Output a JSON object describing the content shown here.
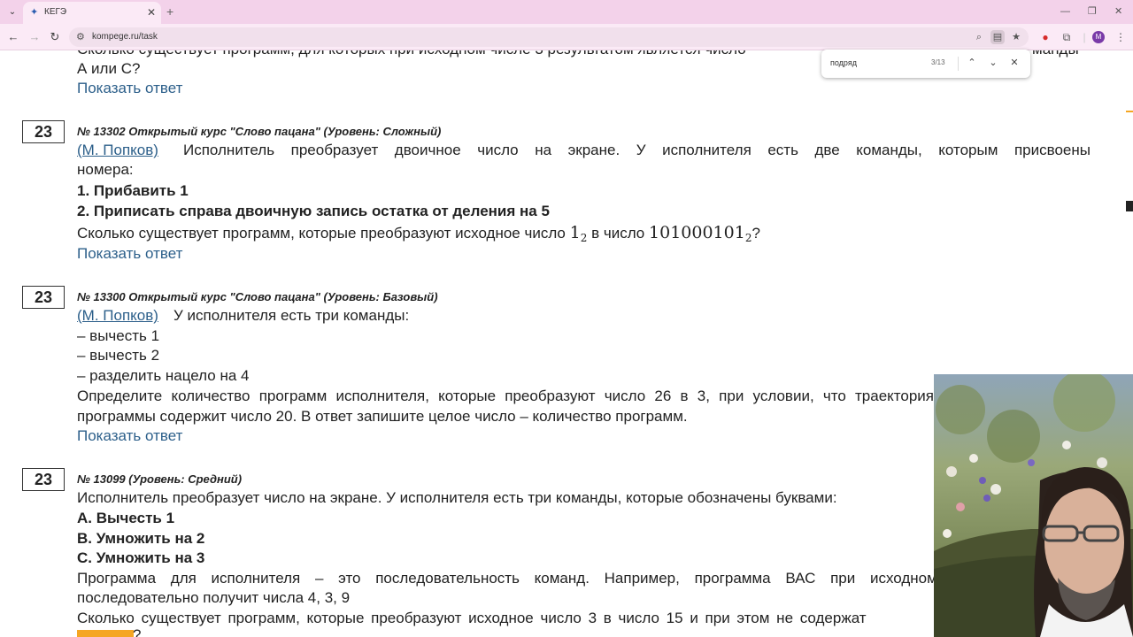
{
  "browser": {
    "tab_title": "КЕГЭ",
    "url": "kompege.ru/task",
    "profile_initial": "M",
    "icons": {
      "tab_list": "chevron-down-icon",
      "tab_favicon": "kegje-favicon-icon",
      "tab_close": "close-icon",
      "new_tab": "plus-icon",
      "back": "arrow-left-icon",
      "forward": "arrow-right-icon",
      "reload": "reload-icon",
      "site_info": "site-settings-icon",
      "zoom": "zoom-icon",
      "reader": "reading-mode-icon",
      "bookmark": "star-icon",
      "extension": "extension-red-icon",
      "extensions": "puzzle-icon",
      "menu": "kebab-menu-icon"
    },
    "find": {
      "query": "подряд",
      "count": "3/13"
    }
  },
  "page": {
    "top_partial": {
      "line1": "Сколько существует программ, для которых при исходном числе 3 результатом является число",
      "line1_tail": "манды",
      "line2": "А или С?",
      "answer_link": "Показать ответ"
    },
    "tasks": [
      {
        "number": "23",
        "meta": "№ 13302 Открытый курс \"Слово пацана\" (Уровень: Сложный)",
        "author": "(М. Попков)",
        "intro": "Исполнитель преобразует двоичное число на экране. У исполнителя есть две команды, которым присвоены",
        "intro2": "номера:",
        "cmd1": "1. Прибавить 1",
        "cmd2": "2. Приписать справа двоичную запись остатка от деления на 5",
        "question_a": "Сколько существует программ, которые преобразуют исходное число",
        "math1": "1",
        "math1_sub": "2",
        "question_b": "в число",
        "math2": "101000101",
        "math2_sub": "2",
        "question_end": "?",
        "answer_link": "Показать ответ"
      },
      {
        "number": "23",
        "meta": "№ 13300 Открытый курс \"Слово пацана\" (Уровень: Базовый)",
        "author": "(М. Попков)",
        "intro": "У исполнителя есть три команды:",
        "cmd1": "– вычесть 1",
        "cmd2": "– вычесть 2",
        "cmd3": "– разделить нацело на 4",
        "body1": "Определите количество программ исполнителя, которые преобразуют число 26 в 3, при условии, что траектория",
        "body2": "программы содержит число 20. В ответ запишите целое число – количество программ.",
        "answer_link": "Показать ответ"
      },
      {
        "number": "23",
        "meta": "№ 13099 (Уровень: Средний)",
        "intro": "Исполнитель преобразует число на экране. У исполнителя есть три команды, которые обозначены буквами:",
        "cmd1": "А. Вычесть 1",
        "cmd2": "В. Умножить на 2",
        "cmd3": "С. Умножить на 3",
        "body1": "Программа для исполнителя – это последовательность команд. Например, программа ВАС при исходном числе 2",
        "body2": "последовательно получит числа 4, 3, 9",
        "body3": "Сколько существует программ, которые преобразуют исходное число 3 в число 15 и при этом не содержат",
        "body4_tail": "?"
      }
    ]
  },
  "colors": {
    "tabbar_bg": "#f3d2ea",
    "toolbar_bg": "#fbeaf6",
    "link": "#2c5f8a",
    "highlight": "#f5a623",
    "profile": "#7a3aa8"
  }
}
